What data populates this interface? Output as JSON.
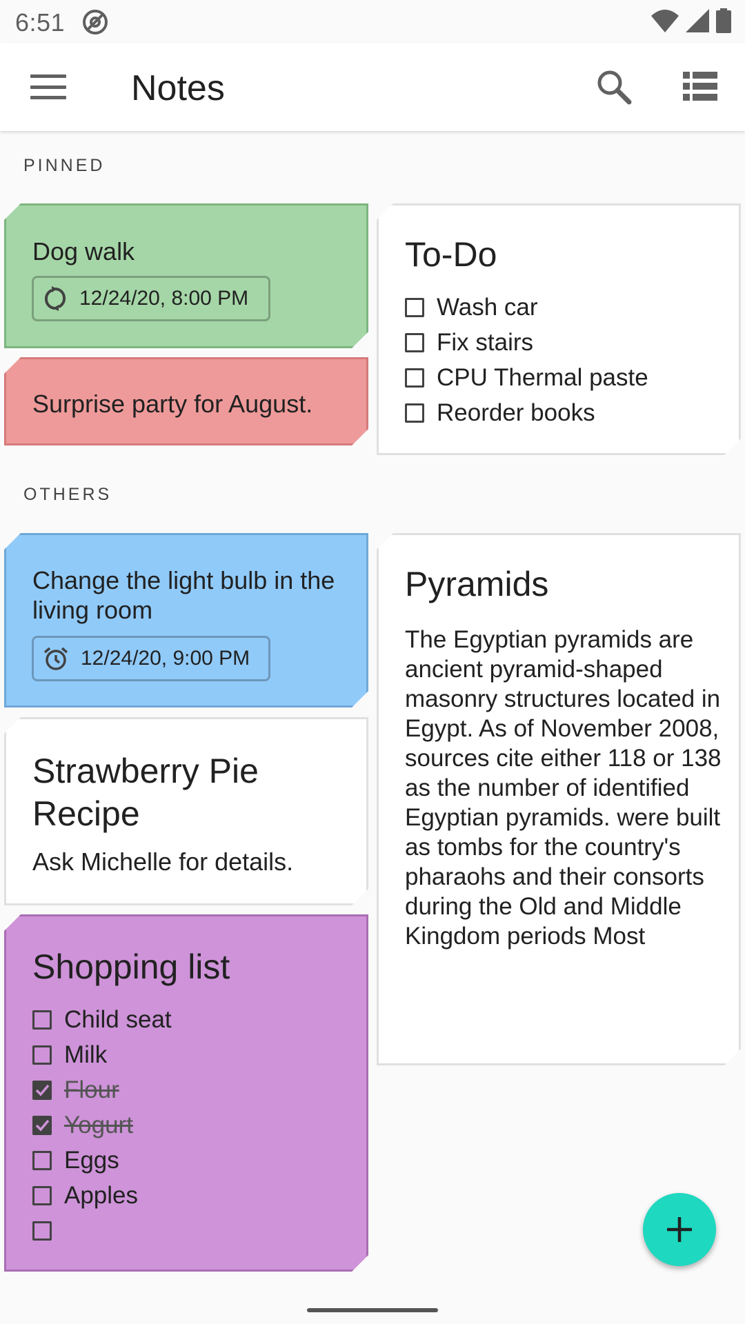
{
  "status": {
    "time": "6:51",
    "icons": [
      "at-sign-icon",
      "wifi-icon",
      "signal-icon",
      "battery-icon"
    ]
  },
  "appbar": {
    "title": "Notes",
    "icons": [
      "menu-icon",
      "search-icon",
      "list-view-icon"
    ]
  },
  "sections": {
    "pinned": "PINNED",
    "others": "OTHERS"
  },
  "colors": {
    "green": "#a5d6a7",
    "red": "#ef9a9a",
    "blue": "#90caf9",
    "purple": "#ce93d8",
    "white": "#ffffff",
    "fab": "#1ed8c0"
  },
  "notes": {
    "dog_walk": {
      "text": "Dog walk",
      "reminder": "12/24/20, 8:00 PM",
      "reminder_icon": "repeat-icon"
    },
    "surprise": {
      "text": "Surprise party for August."
    },
    "todo": {
      "title": "To-Do",
      "items": [
        {
          "text": "Wash car",
          "checked": false
        },
        {
          "text": "Fix stairs",
          "checked": false
        },
        {
          "text": "CPU Thermal paste",
          "checked": false
        },
        {
          "text": "Reorder books",
          "checked": false
        }
      ]
    },
    "light_bulb": {
      "text": "Change the light bulb in the living room",
      "reminder": "12/24/20, 9:00 PM",
      "reminder_icon": "alarm-icon"
    },
    "pyramids": {
      "title": "Pyramids",
      "body": "The Egyptian pyramids are ancient pyramid-shaped masonry structures located in Egypt. As of November 2008, sources cite either 118 or 138 as the number of identified Egyptian pyramids. were built as tombs for the country's pharaohs and their consorts during the Old and Middle Kingdom periods Most"
    },
    "strawberry": {
      "title": "Strawberry Pie Recipe",
      "body": "Ask Michelle for details."
    },
    "shopping": {
      "title": "Shopping list",
      "items": [
        {
          "text": "Child seat",
          "checked": false
        },
        {
          "text": "Milk",
          "checked": false
        },
        {
          "text": "Flour",
          "checked": true
        },
        {
          "text": "Yogurt",
          "checked": true
        },
        {
          "text": "Eggs",
          "checked": false
        },
        {
          "text": "Apples",
          "checked": false
        },
        {
          "text": "",
          "checked": false
        }
      ]
    }
  },
  "fab": {
    "icon": "plus-icon"
  }
}
